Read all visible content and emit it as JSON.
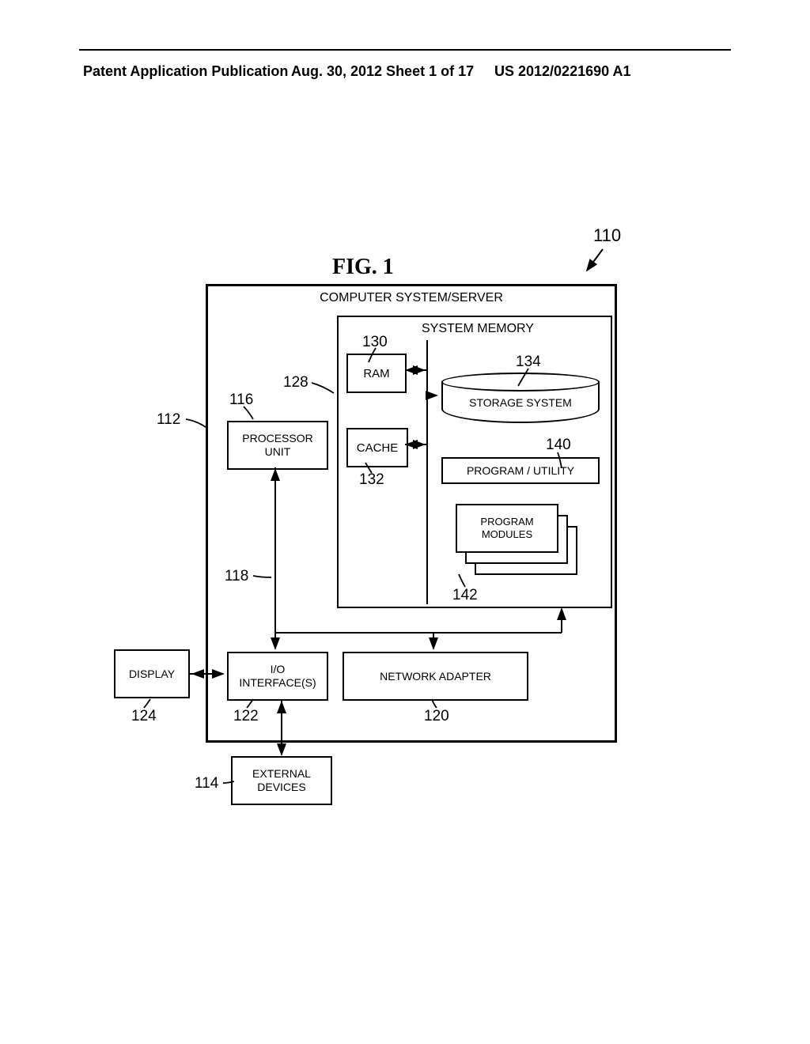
{
  "header": {
    "left": "Patent Application Publication",
    "center": "Aug. 30, 2012  Sheet 1 of 17",
    "right": "US 2012/0221690 A1"
  },
  "figure": {
    "title": "FIG. 1",
    "main_ref": "110",
    "outer_title": "COMPUTER SYSTEM/SERVER",
    "memory_title": "SYSTEM MEMORY",
    "ram": "RAM",
    "cache": "CACHE",
    "storage": "STORAGE SYSTEM",
    "program_utility": "PROGRAM / UTILITY",
    "program_modules": "PROGRAM\nMODULES",
    "processor": "PROCESSOR\nUNIT",
    "io": "I/O\nINTERFACE(S)",
    "network": "NETWORK ADAPTER",
    "display": "DISPLAY",
    "external": "EXTERNAL\nDEVICES"
  },
  "refs": {
    "r110": "110",
    "r112": "112",
    "r114": "114",
    "r116": "116",
    "r118": "118",
    "r120": "120",
    "r122": "122",
    "r124": "124",
    "r128": "128",
    "r130": "130",
    "r132": "132",
    "r134": "134",
    "r140": "140",
    "r142": "142"
  }
}
